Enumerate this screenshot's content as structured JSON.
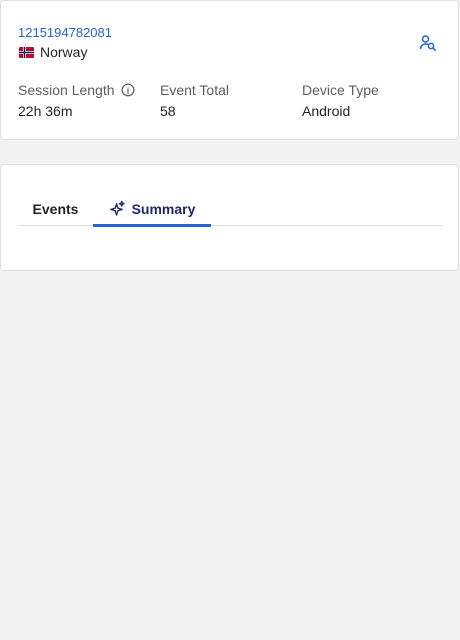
{
  "session": {
    "id": "1215194782081",
    "country": "Norway",
    "flag_icon": "norway-flag-icon"
  },
  "stats": [
    {
      "label": "Session Length",
      "value": "22h 36m",
      "has_info": true
    },
    {
      "label": "Event Total",
      "value": "58",
      "has_info": false
    },
    {
      "label": "Device Type",
      "value": "Android",
      "has_info": false
    }
  ],
  "tabs": [
    {
      "label": "Events",
      "active": false
    },
    {
      "label": "Summary",
      "active": true,
      "icon": "sparkle-icon"
    }
  ],
  "colors": {
    "accent": "#2563d6",
    "active_tab_text": "#1b2a6b",
    "background": "#f3f3f3",
    "card": "#ffffff"
  }
}
